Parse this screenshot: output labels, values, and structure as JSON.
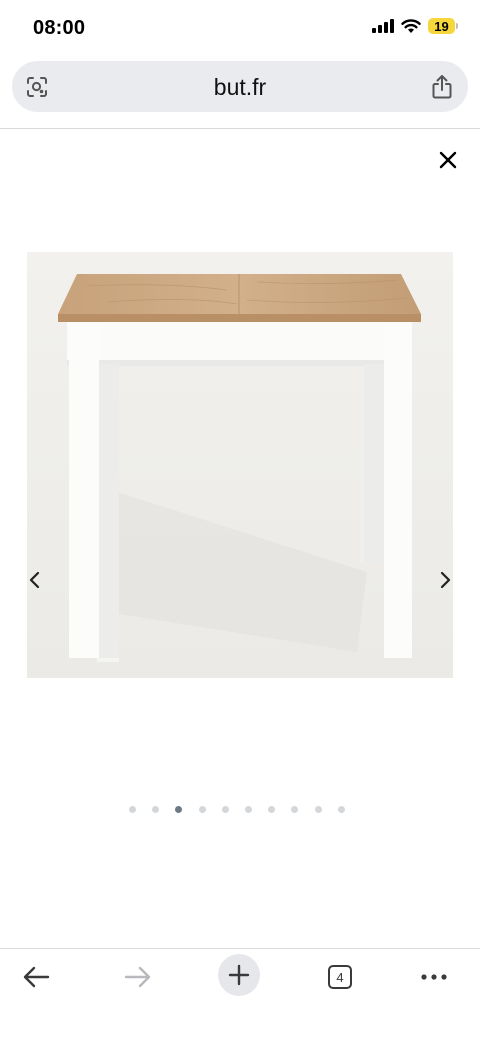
{
  "status_bar": {
    "time": "08:00",
    "battery_level": "19"
  },
  "address_bar": {
    "url": "but.fr"
  },
  "gallery": {
    "image_alt": "product-photo-table",
    "total_slides": 10,
    "active_index": 2
  },
  "toolbar": {
    "tab_count": "4"
  },
  "colors": {
    "image_bg": "#f1f0ec",
    "tabletop": "#c9a57f",
    "dot_active": "#6c7a85",
    "dot_inactive": "#d4d7da"
  }
}
